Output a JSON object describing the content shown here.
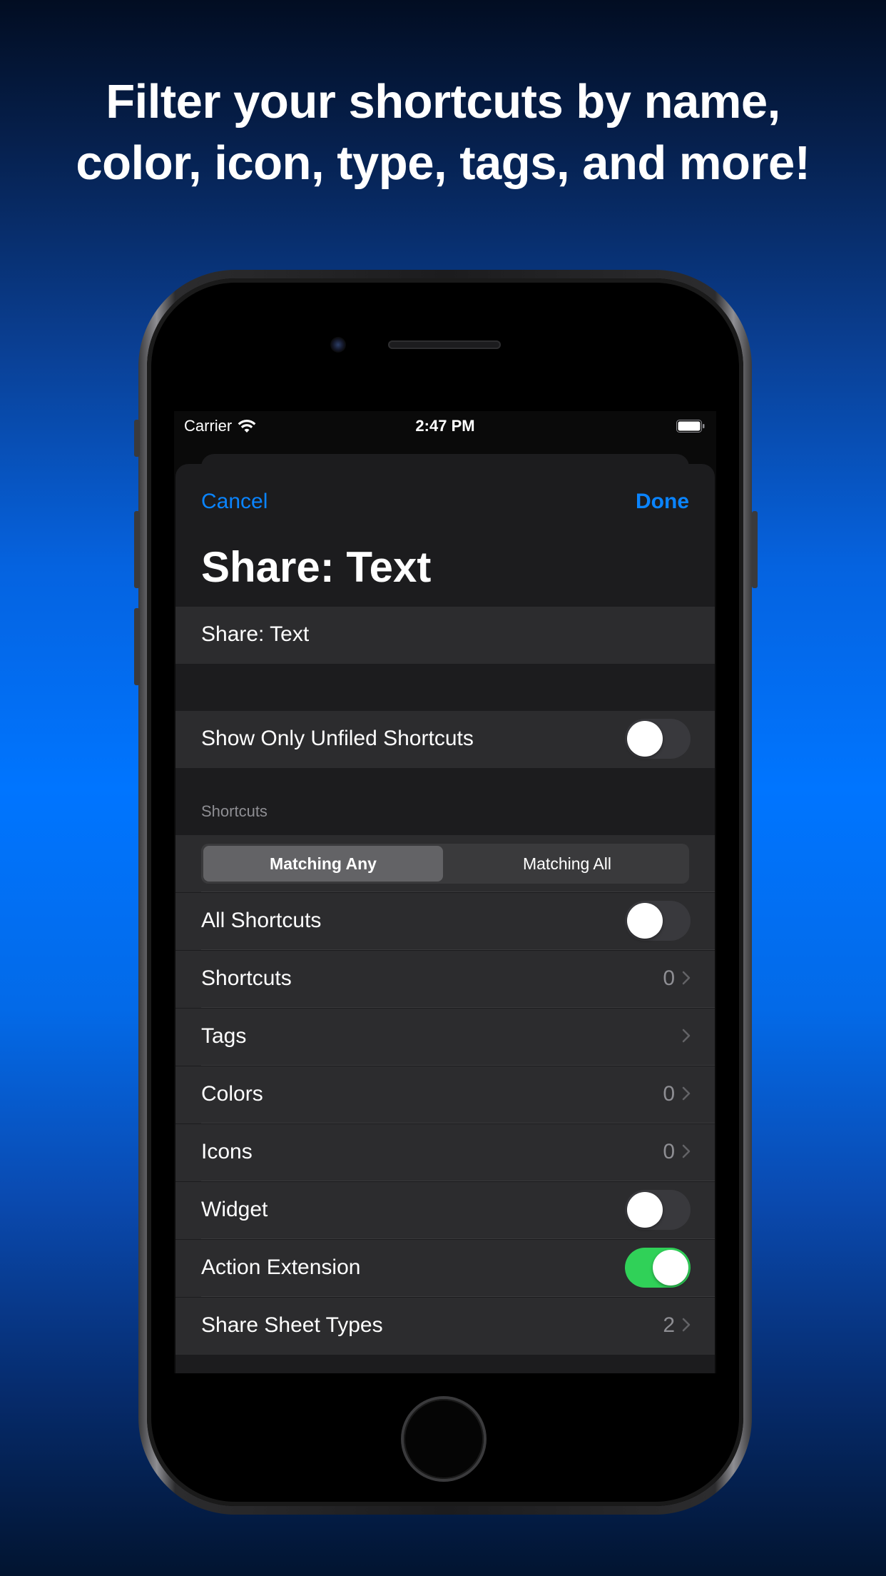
{
  "headline": {
    "line1": "Filter your shortcuts by name,",
    "line2": "color, icon, type, tags, and more!"
  },
  "status_bar": {
    "carrier": "Carrier",
    "time": "2:47 PM"
  },
  "nav": {
    "cancel": "Cancel",
    "done": "Done"
  },
  "title": "Share: Text",
  "name_field": {
    "value": "Share: Text"
  },
  "unfiled": {
    "label": "Show Only Unfiled Shortcuts",
    "on": false
  },
  "shortcuts_section": {
    "header": "Shortcuts",
    "segments": [
      "Matching Any",
      "Matching All"
    ],
    "selected_segment": "Matching Any",
    "rows": [
      {
        "label": "All Shortcuts",
        "kind": "toggle",
        "on": false
      },
      {
        "label": "Shortcuts",
        "kind": "disclosure",
        "value": "0"
      },
      {
        "label": "Tags",
        "kind": "disclosure",
        "value": ""
      },
      {
        "label": "Colors",
        "kind": "disclosure",
        "value": "0"
      },
      {
        "label": "Icons",
        "kind": "disclosure",
        "value": "0"
      },
      {
        "label": "Widget",
        "kind": "toggle",
        "on": false
      },
      {
        "label": "Action Extension",
        "kind": "toggle",
        "on": true
      },
      {
        "label": "Share Sheet Types",
        "kind": "disclosure",
        "value": "2"
      }
    ]
  },
  "colors": {
    "accent": "#0a84ff",
    "toggle_on": "#30d158",
    "toggle_off": "#39393d"
  }
}
